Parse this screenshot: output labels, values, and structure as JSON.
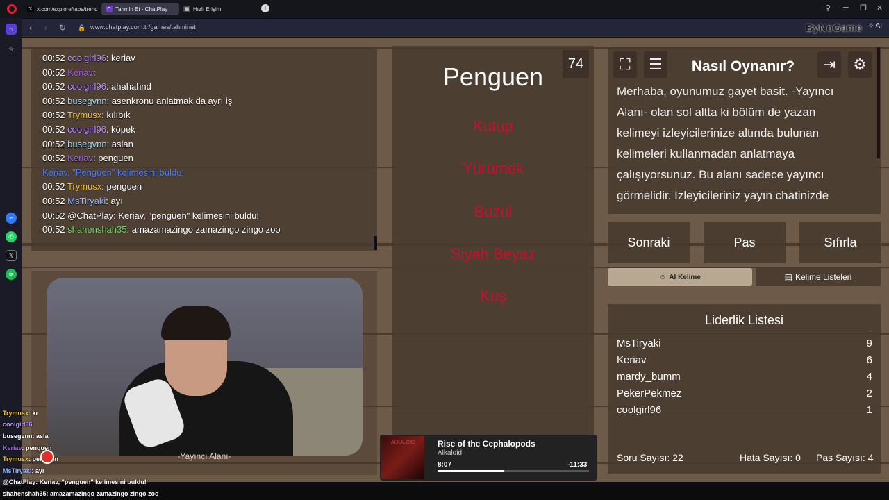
{
  "browser": {
    "tabs": [
      {
        "label": "x.com/explore/tabs/trend",
        "icon": "x-icon"
      },
      {
        "label": "Tahmin Et - ChatPlay",
        "icon": "chatplay-icon"
      },
      {
        "label": "Hızlı Erişim",
        "icon": "grid-icon"
      }
    ],
    "url": "www.chatplay.com.tr/games/tahminet",
    "ai_label": "AI",
    "watermark": "ByNoGame"
  },
  "chat": [
    {
      "time": "00:52",
      "user": "coolgirl96",
      "color": "#b98dff",
      "msg": ": keriav"
    },
    {
      "time": "00:52",
      "user": "Keriav",
      "color": "#a25ee6",
      "msg": ":"
    },
    {
      "time": "00:52",
      "user": "coolgirl96",
      "color": "#b98dff",
      "msg": ": ahahahnd"
    },
    {
      "time": "00:52",
      "user": "busegvnn",
      "color": "#9ad6f0",
      "msg": ": asenkronu anlatmak da ayrı iş"
    },
    {
      "time": "00:52",
      "user": "Trymusx",
      "color": "#f1c232",
      "msg": ": kılıbık"
    },
    {
      "time": "00:52",
      "user": "coolgirl96",
      "color": "#b98dff",
      "msg": ": köpek"
    },
    {
      "time": "00:52",
      "user": "busegvnn",
      "color": "#9ad6f0",
      "msg": ": aslan"
    },
    {
      "time": "00:52",
      "user": "Keriav",
      "color": "#a25ee6",
      "msg": ": penguen"
    },
    {
      "system": "Keriav, \"Penguen\" kelimesini buldu!"
    },
    {
      "time": "00:52",
      "user": "Trymusx",
      "color": "#f1c232",
      "msg": ": penguen"
    },
    {
      "time": "00:52",
      "user": "MsTiryaki",
      "color": "#8db5ff",
      "msg": ": ayı"
    },
    {
      "time": "00:52",
      "user": "@ChatPlay",
      "color": "#ffffff",
      "msg": ": Keriav, \"penguen\" kelimesini buldu!"
    },
    {
      "time": "00:52",
      "user": "shahenshah35",
      "color": "#7bd36b",
      "msg": ": amazamazingo zamazingo zingo zoo"
    }
  ],
  "streamer_area_label": "-Yayıncı Alanı-",
  "game": {
    "timer": "74",
    "word": "Penguen",
    "forbidden": [
      "Kutup",
      "Yürümek",
      "Buzul",
      "Siyah Beyaz",
      "Kuş"
    ]
  },
  "music": {
    "title": "Rise of the Cephalopods",
    "artist": "Alkaloid",
    "elapsed": "8:07",
    "remaining": "-11:33",
    "progress": 0.44,
    "cover_text": "ALKALOID"
  },
  "howto": {
    "title": "Nasıl Oynanır?",
    "text": "Merhaba, oyunumuz gayet basit. -Yayıncı Alanı- olan sol altta ki bölüm de yazan kelimeyi izleyicilerinize altında bulunan kelimeleri kullanmadan anlatmaya çalışıyorsunuz. Bu alanı sadece yayıncı görmelidir. İzleyicileriniz yayın chatinizde tahmin etmelidir."
  },
  "controls": {
    "next": "Sonraki",
    "pass": "Pas",
    "reset": "Sıfırla",
    "ai_word": "AI Kelime",
    "word_lists": "Kelime Listeleri"
  },
  "leaderboard": {
    "title": "Liderlik Listesi",
    "rows": [
      {
        "name": "MsTiryaki",
        "score": "9"
      },
      {
        "name": "Keriav",
        "score": "6"
      },
      {
        "name": "mardy_bumm",
        "score": "4"
      },
      {
        "name": "PekerPekmez",
        "score": "2"
      },
      {
        "name": "coolgirl96",
        "score": "1"
      }
    ]
  },
  "stats": {
    "questions": "Soru Sayısı: 22",
    "errors": "Hata Sayısı: 0",
    "passes": "Pas Sayısı: 4"
  },
  "overlay_chat": [
    {
      "user": "Trymusx",
      "color": "#f1c232",
      "msg": ": kı"
    },
    {
      "user": "coolgirl96",
      "color": "#b98dff",
      "msg": ""
    },
    {
      "user": "busegvnn",
      "color": "#ffffff",
      "msg": ": asla"
    },
    {
      "user": "Keriav",
      "color": "#a25ee6",
      "msg": ": penguen"
    },
    {
      "user": "Trymusx",
      "color": "#f1c232",
      "msg": ": penguen"
    },
    {
      "user": "MsTiryaki",
      "color": "#8db5ff",
      "msg": ": ayı"
    },
    {
      "user": "@ChatPlay",
      "color": "#ffffff",
      "msg": ": Keriav, \"penguen\" kelimesini buldu!"
    },
    {
      "user": "shahenshah35",
      "color": "#ffffff",
      "msg": ": amazamazingo zamazingo zingo zoo"
    }
  ]
}
